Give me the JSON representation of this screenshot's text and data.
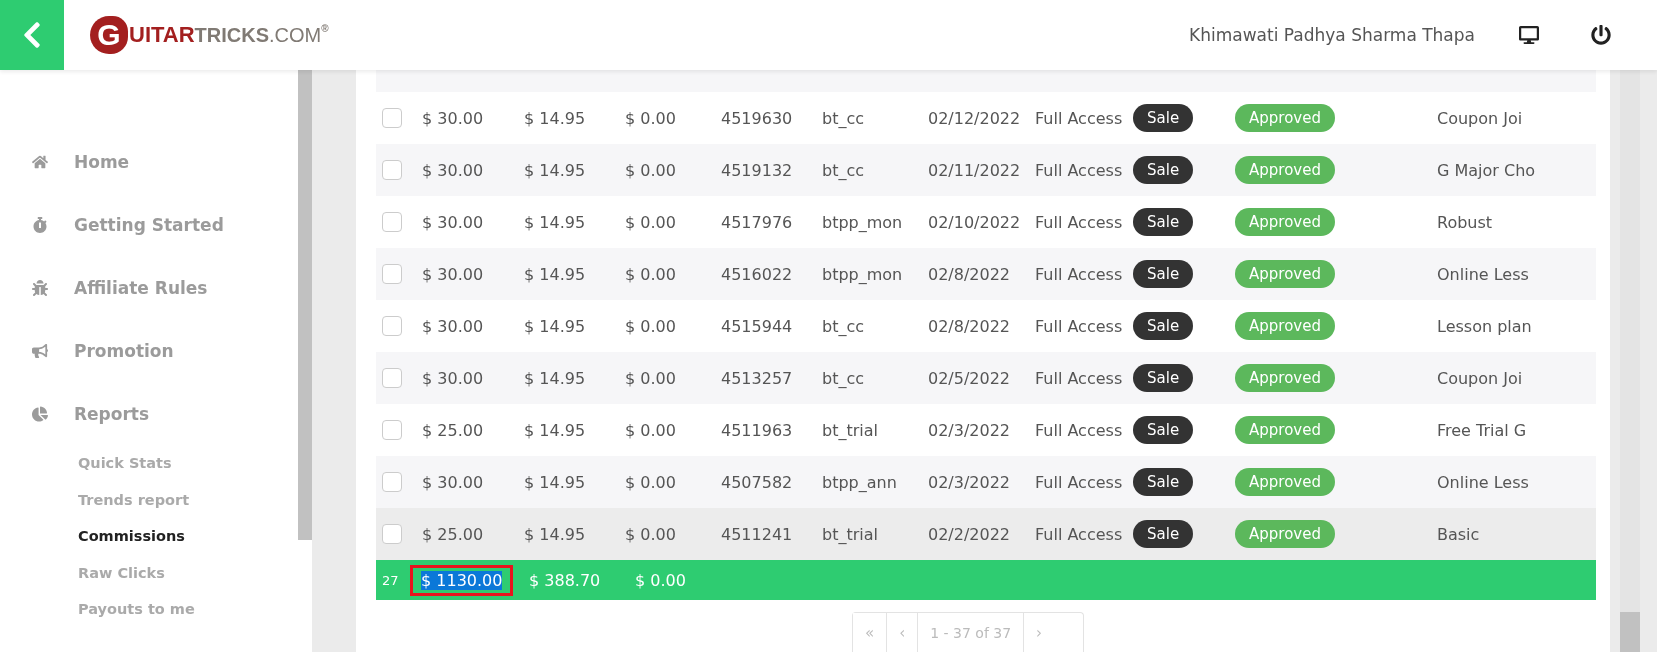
{
  "header": {
    "logo": {
      "lead": "G",
      "mid": "UITAR",
      "strong": "TRICKS",
      "suffix": ".COM",
      "mark": "®"
    },
    "user": "Khimawati Padhya Sharma Thapa"
  },
  "sidebar": {
    "items": [
      {
        "label": "Home"
      },
      {
        "label": "Getting Started"
      },
      {
        "label": "Affiliate Rules"
      },
      {
        "label": "Promotion"
      },
      {
        "label": "Reports"
      }
    ],
    "subitems": [
      {
        "label": "Quick Stats",
        "selected": false
      },
      {
        "label": "Trends report",
        "selected": false
      },
      {
        "label": "Commissions",
        "selected": true
      },
      {
        "label": "Raw Clicks",
        "selected": false
      },
      {
        "label": "Payouts to me",
        "selected": false
      }
    ]
  },
  "table": {
    "rows": [
      {
        "checked": false,
        "highlighted": false,
        "sale": "$ 30.00",
        "commission": "$ 14.95",
        "refund": "$ 0.00",
        "order": "4519630",
        "code": "bt_cc",
        "date": "02/12/2022",
        "product": "Full Access",
        "type": "Sale",
        "status": "Approved",
        "description": "Coupon Joi"
      },
      {
        "checked": false,
        "highlighted": false,
        "sale": "$ 30.00",
        "commission": "$ 14.95",
        "refund": "$ 0.00",
        "order": "4519132",
        "code": "bt_cc",
        "date": "02/11/2022",
        "product": "Full Access",
        "type": "Sale",
        "status": "Approved",
        "description": "G Major Cho"
      },
      {
        "checked": false,
        "highlighted": false,
        "sale": "$ 30.00",
        "commission": "$ 14.95",
        "refund": "$ 0.00",
        "order": "4517976",
        "code": "btpp_mon",
        "date": "02/10/2022",
        "product": "Full Access",
        "type": "Sale",
        "status": "Approved",
        "description": "Robust"
      },
      {
        "checked": false,
        "highlighted": false,
        "sale": "$ 30.00",
        "commission": "$ 14.95",
        "refund": "$ 0.00",
        "order": "4516022",
        "code": "btpp_mon",
        "date": "02/8/2022",
        "product": "Full Access",
        "type": "Sale",
        "status": "Approved",
        "description": "Online Less"
      },
      {
        "checked": false,
        "highlighted": false,
        "sale": "$ 30.00",
        "commission": "$ 14.95",
        "refund": "$ 0.00",
        "order": "4515944",
        "code": "bt_cc",
        "date": "02/8/2022",
        "product": "Full Access",
        "type": "Sale",
        "status": "Approved",
        "description": "Lesson plan"
      },
      {
        "checked": false,
        "highlighted": false,
        "sale": "$ 30.00",
        "commission": "$ 14.95",
        "refund": "$ 0.00",
        "order": "4513257",
        "code": "bt_cc",
        "date": "02/5/2022",
        "product": "Full Access",
        "type": "Sale",
        "status": "Approved",
        "description": "Coupon Joi"
      },
      {
        "checked": false,
        "highlighted": false,
        "sale": "$ 25.00",
        "commission": "$ 14.95",
        "refund": "$ 0.00",
        "order": "4511963",
        "code": "bt_trial",
        "date": "02/3/2022",
        "product": "Full Access",
        "type": "Sale",
        "status": "Approved",
        "description": "Free Trial G"
      },
      {
        "checked": false,
        "highlighted": false,
        "sale": "$ 30.00",
        "commission": "$ 14.95",
        "refund": "$ 0.00",
        "order": "4507582",
        "code": "btpp_ann",
        "date": "02/3/2022",
        "product": "Full Access",
        "type": "Sale",
        "status": "Approved",
        "description": "Online Less"
      },
      {
        "checked": false,
        "highlighted": true,
        "sale": "$ 25.00",
        "commission": "$ 14.95",
        "refund": "$ 0.00",
        "order": "4511241",
        "code": "bt_trial",
        "date": "02/2/2022",
        "product": "Full Access",
        "type": "Sale",
        "status": "Approved",
        "description": "Basic"
      }
    ],
    "total": {
      "count": "27",
      "sale": "$ 1130.00",
      "sale_selected": true,
      "sale_outlined": true,
      "commission": "$ 388.70",
      "refund": "$ 0.00"
    }
  },
  "pagination": {
    "first": "«",
    "prev": "‹",
    "info": "1 - 37 of 37",
    "next": "›"
  }
}
